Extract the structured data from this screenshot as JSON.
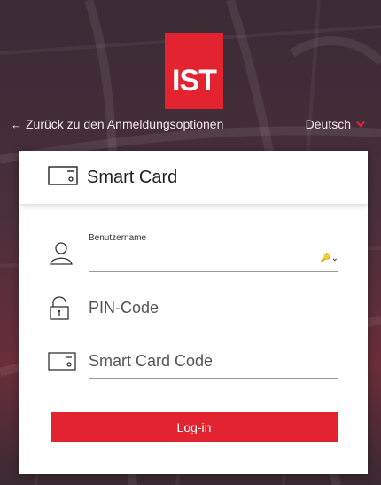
{
  "brand": {
    "logo_text": "IST",
    "accent_color": "#e3232f"
  },
  "nav": {
    "back_arrow": "←",
    "back_label": "Zurück zu den Anmeldungsoptionen",
    "language": "Deutsch",
    "language_chevron": "▾"
  },
  "card": {
    "title": "Smart Card",
    "title_icon": "smart-card-icon"
  },
  "form": {
    "username_label": "Benutzername",
    "username_value": "",
    "username_icon": "user-icon",
    "key_menu_glyph": "🔑⌄",
    "pin_placeholder": "PIN-Code",
    "pin_icon": "lock-icon",
    "smartcard_placeholder": "Smart Card Code",
    "smartcard_icon": "smart-card-icon"
  },
  "actions": {
    "login_label": "Log-in"
  }
}
